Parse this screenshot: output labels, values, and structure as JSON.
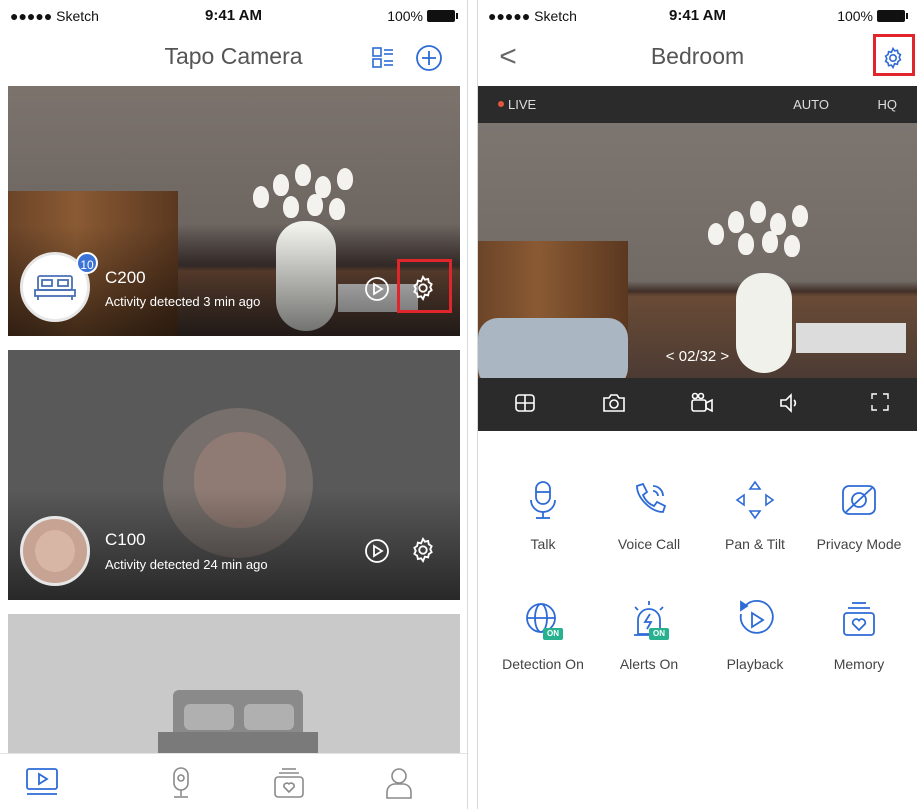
{
  "colors": {
    "accent": "#2e6bd6",
    "highlight": "#e0262c",
    "live": "#e4573d",
    "on_badge": "#27b18f"
  },
  "left": {
    "status": {
      "carrier": "●●●●● Sketch",
      "time": "9:41 AM",
      "battery": "100%"
    },
    "header": {
      "title": "Tapo Camera",
      "layout_icon": "layout-grid-icon",
      "add_icon": "add-circle-icon"
    },
    "cameras": [
      {
        "name": "C200",
        "activity": "Activity detected 3 min ago",
        "badge": "10"
      },
      {
        "name": "C100",
        "activity": "Activity detected 24 min ago"
      }
    ],
    "tabs": [
      "camera-tab-icon",
      "device-tab-icon",
      "memory-tab-icon",
      "profile-tab-icon"
    ]
  },
  "right": {
    "status": {
      "carrier": "●●●●● Sketch",
      "time": "9:41 AM",
      "battery": "100%"
    },
    "header": {
      "title": "Bedroom",
      "back": "<"
    },
    "live_bar": {
      "live": "LIVE",
      "auto": "AUTO",
      "hq": "HQ"
    },
    "counter": "<  02/32  >",
    "functions": [
      {
        "label": "Talk"
      },
      {
        "label": "Voice Call"
      },
      {
        "label": "Pan & Tilt"
      },
      {
        "label": "Privacy Mode"
      },
      {
        "label": "Detection On",
        "tag": "ON"
      },
      {
        "label": "Alerts On",
        "tag": "ON"
      },
      {
        "label": "Playback"
      },
      {
        "label": "Memory"
      }
    ]
  }
}
